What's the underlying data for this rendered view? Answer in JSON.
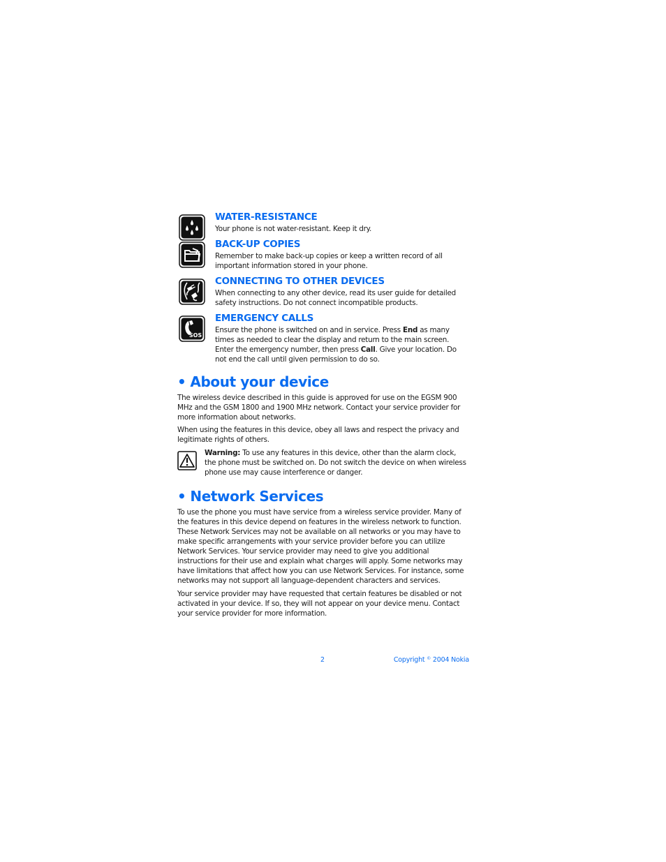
{
  "safety_items": [
    {
      "icon": "water-drops-icon",
      "title": "WATER-RESISTANCE",
      "text": "Your phone is not water-resistant. Keep it dry."
    },
    {
      "icon": "folder-icon",
      "title": "BACK-UP COPIES",
      "text": "Remember to make back-up copies or keep a written record of all important information stored in your phone."
    },
    {
      "icon": "plug-cable-icon",
      "title": "CONNECTING TO OTHER DEVICES",
      "text": "When connecting to any other device, read its user guide for detailed safety instructions. Do not connect incompatible products."
    },
    {
      "icon": "sos-phone-icon",
      "title": "EMERGENCY CALLS",
      "text_parts": {
        "a": "Ensure the phone is switched on and in service. Press ",
        "b_bold": "End",
        "c": " as many times as needed to clear the display and return to the main screen. Enter the emergency number, then press ",
        "d_bold": "Call",
        "e": ". Give your location. Do not end the call until given permission to do so."
      }
    }
  ],
  "about": {
    "bullet": "•",
    "heading": "About your device",
    "paragraphs": [
      "The wireless device described in this guide is approved for use on the EGSM 900 MHz and the GSM 1800 and 1900 MHz network. Contact your service provider for more information about networks.",
      "When using the features in this device, obey all laws and respect the privacy and legitimate rights of others."
    ],
    "warning": {
      "icon": "warning-triangle-icon",
      "label": "Warning:",
      "text": " To use any features in this device, other than the alarm clock, the phone must be switched on. Do not switch the device on when wireless phone use may cause interference or danger."
    }
  },
  "network": {
    "bullet": "•",
    "heading": "Network Services",
    "paragraphs": [
      "To use the phone you must have service from a wireless service provider. Many of the features in this device depend on features in the wireless network to function. These Network Services may not be available on all networks or you may have to make specific arrangements with your service provider before you can utilize Network Services. Your service provider may need to give you additional instructions for their use and explain what charges will apply. Some networks may have limitations that affect how you can use Network Services. For instance, some networks may not support all language-dependent characters and services.",
      "Your service provider may have requested that certain features be disabled or not activated in your device. If so, they will not appear on your device menu. Contact your service provider for more information."
    ]
  },
  "footer": {
    "page_number": "2",
    "copyright_prefix": "Copyright ",
    "copyright_symbol": "©",
    "copyright_suffix": " 2004 Nokia"
  },
  "colors": {
    "accent_blue": "#0a6cf0",
    "text": "#1a1a1a"
  }
}
